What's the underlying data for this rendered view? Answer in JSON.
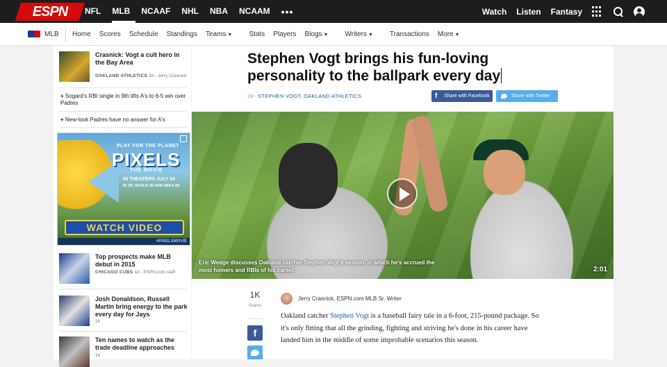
{
  "topnav": {
    "logo": "ESPN",
    "sports": [
      {
        "label": "NFL"
      },
      {
        "label": "MLB",
        "active": true
      },
      {
        "label": "NCAAF"
      },
      {
        "label": "NHL"
      },
      {
        "label": "NBA"
      },
      {
        "label": "NCAAM"
      }
    ],
    "more": "•••",
    "right": {
      "watch": "Watch",
      "listen": "Listen",
      "fantasy": "Fantasy"
    },
    "icons": [
      "grid-icon",
      "search-icon",
      "user-icon"
    ]
  },
  "subnav": {
    "league": "MLB",
    "links": [
      "Home",
      "Scores",
      "Schedule",
      "Standings",
      "Teams",
      "Stats",
      "Players",
      "Blogs",
      "Writers",
      "Transactions",
      "More"
    ]
  },
  "sidebar": {
    "lead": {
      "title": "Crasnick: Vogt a cult hero in the Bay Area",
      "tag": "OAKLAND ATHLETICS",
      "meta": "2d - Jerry Crasnick"
    },
    "bullets": [
      "Sogard's RBI single in 9th lifts A's to 6-5 win over Padres",
      "New-look Padres have no answer for A's"
    ],
    "ad": {
      "line1": "PLAY FOR THE PLANET",
      "brand": "PIXELS",
      "line2": "THE MOVIE",
      "line3": "IN THEATERS JULY 24",
      "line4": "IN 3D, REALD 3D AND IMAX 3D",
      "button": "WATCH VIDEO",
      "hashtag": "#PIXELSMOVIE"
    },
    "stories": [
      {
        "title": "Top prospects make MLB debut in 2015",
        "tag": "CHICAGO CUBS",
        "meta": "1d - ESPN.com staff"
      },
      {
        "title": "Josh Donaldson, Russell Martin bring energy to the park every day for Jays",
        "tag": "",
        "meta": "1h"
      },
      {
        "title": "Ten names to watch as the trade deadline approaches",
        "tag": "",
        "meta": "1h"
      }
    ]
  },
  "article": {
    "headline": "Stephen Vogt brings his fun-loving personality to the ballpark every day",
    "byline_time": "2d -",
    "byline_tags": [
      "STEPHEN VOGT,",
      "OAKLAND ATHLETICS"
    ],
    "share_facebook": "Share with Facebook",
    "share_twitter": "Share with Twitter",
    "video_caption": "Eric Wedge discusses Oakland catcher Stephen Vogt's season, in which he's accrued the most homers and RBIs of his career.",
    "video_duration": "2:01",
    "shares_count": "1K",
    "shares_label": "Shares",
    "author": "Jerry Crasnick, ESPN.com MLB Sr. Writer",
    "body_pre": "Oakland catcher ",
    "body_link": "Stephen Vogt",
    "body_post": " is a baseball fairy tale in a 6-foot, 215-pound package. So it's only fitting that all the grinding, fighting and striving he's done in his career have landed him in the middle of some improbable scenarios this season."
  },
  "colors": {
    "espn_red": "#d50a0a",
    "nav_bg": "#1d1d1d",
    "link": "#1c5da8",
    "facebook": "#3b5998",
    "twitter": "#55acee"
  }
}
